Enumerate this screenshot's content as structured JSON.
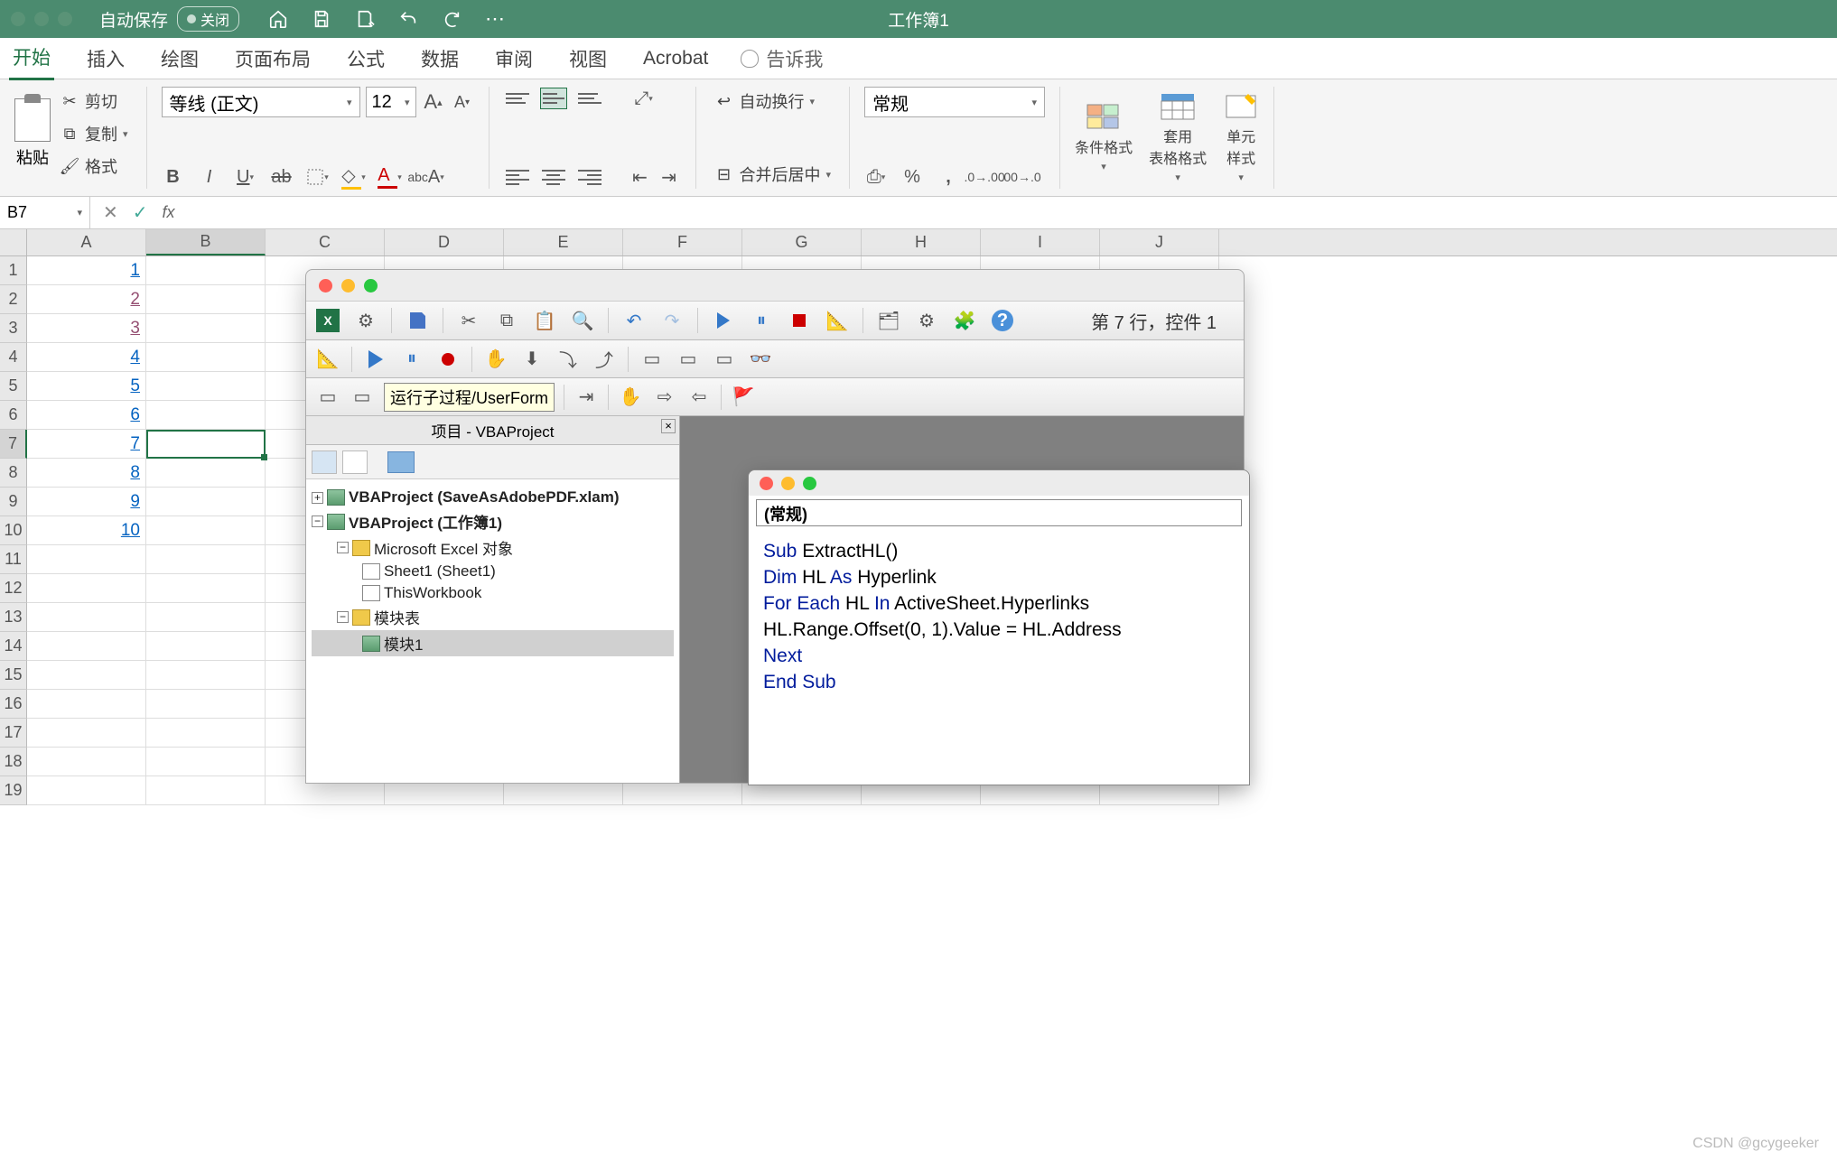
{
  "titlebar": {
    "autosave_label": "自动保存",
    "autosave_state": "关闭",
    "workbook_title": "工作簿1"
  },
  "ribbon_tabs": [
    "开始",
    "插入",
    "绘图",
    "页面布局",
    "公式",
    "数据",
    "审阅",
    "视图",
    "Acrobat"
  ],
  "tell_me": "告诉我",
  "clipboard": {
    "cut": "剪切",
    "copy": "复制",
    "format": "格式",
    "paste": "粘贴"
  },
  "font": {
    "name": "等线 (正文)",
    "size": "12"
  },
  "alignment": {
    "wrap": "自动换行",
    "merge": "合并后居中"
  },
  "number_format": "常规",
  "styles": {
    "cond": "条件格式",
    "table": "套用\n表格格式",
    "cell": "单元\n样式"
  },
  "namebox": "B7",
  "columns": [
    "A",
    "B",
    "C",
    "D",
    "E",
    "F",
    "G",
    "H",
    "I",
    "J"
  ],
  "rows": [
    "1",
    "2",
    "3",
    "4",
    "5",
    "6",
    "7",
    "8",
    "9",
    "10",
    "11",
    "12",
    "13",
    "14",
    "15",
    "16",
    "17",
    "18",
    "19"
  ],
  "cell_data": {
    "A1": "1",
    "A2": "2",
    "A3": "3",
    "A4": "4",
    "A5": "5",
    "A6": "6",
    "A7": "7",
    "A8": "8",
    "A9": "9",
    "A10": "10"
  },
  "vba": {
    "status": "第 7 行，控件 1",
    "tooltip": "运行子过程/UserForm",
    "project_title": "项目 - VBAProject",
    "tree": {
      "p1": "VBAProject (SaveAsAdobePDF.xlam)",
      "p2": "VBAProject (工作簿1)",
      "excel_objects": "Microsoft Excel 对象",
      "sheet1": "Sheet1 (Sheet1)",
      "thiswb": "ThisWorkbook",
      "modules": "模块表",
      "mod1": "模块1"
    }
  },
  "code": {
    "dropdown": "(常规)",
    "lines": [
      {
        "t": "Sub ",
        "k": true,
        "r": "ExtractHL()"
      },
      {
        "t": "Dim ",
        "k": true,
        "r": "HL ",
        "k2": "As ",
        "r2": "Hyperlink"
      },
      {
        "t": "For Each ",
        "k": true,
        "r": "HL ",
        "k2": "In ",
        "r2": "ActiveSheet.Hyperlinks"
      },
      {
        "t": "",
        "k": false,
        "r": "HL.Range.Offset(0, 1).Value = HL.Address"
      },
      {
        "t": "Next",
        "k": true,
        "r": ""
      },
      {
        "t": "End Sub",
        "k": true,
        "r": ""
      }
    ]
  },
  "watermark": "CSDN @gcygeeker"
}
